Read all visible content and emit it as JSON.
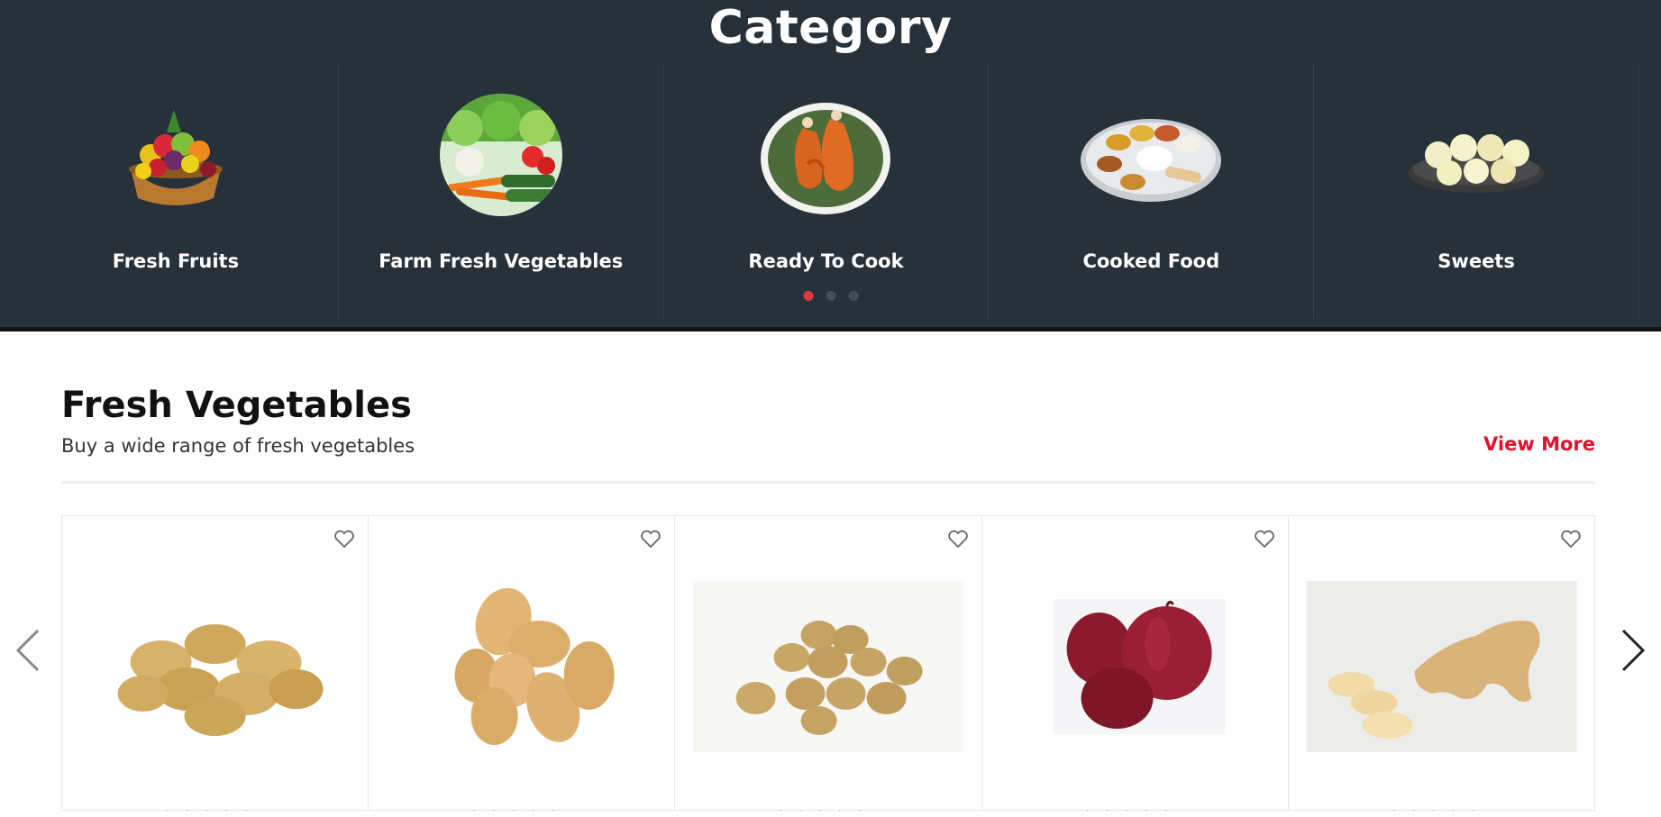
{
  "category": {
    "title": "Category",
    "items": [
      {
        "label": "Fresh Fruits",
        "icon": "fruit-basket-image"
      },
      {
        "label": "Farm Fresh Vegetables",
        "icon": "vegetables-image"
      },
      {
        "label": "Ready To Cook",
        "icon": "chicken-image"
      },
      {
        "label": "Cooked Food",
        "icon": "thali-plate-image"
      },
      {
        "label": "Sweets",
        "icon": "sweets-plate-image"
      }
    ],
    "active_page": 1,
    "page_count": 3,
    "colors": {
      "background": "#26313a",
      "active_dot": "#e23a44"
    }
  },
  "section": {
    "title": "Fresh Vegetables",
    "subtitle": "Buy a wide range of fresh vegetables",
    "view_more": "View More"
  },
  "products": [
    {
      "image": "potatoes-image"
    },
    {
      "image": "potatoes-image"
    },
    {
      "image": "baby-potatoes-image"
    },
    {
      "image": "red-onions-image"
    },
    {
      "image": "ginger-image"
    }
  ],
  "icons": {
    "wishlist": "heart-icon",
    "prev": "chevron-left-icon",
    "next": "chevron-right-icon"
  }
}
